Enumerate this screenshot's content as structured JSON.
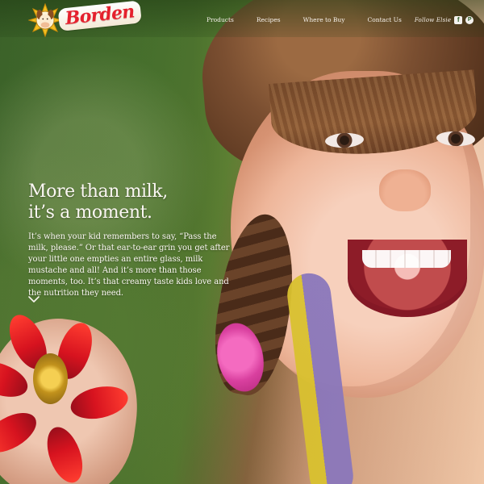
{
  "header": {
    "brand": {
      "wordmark": "Borden",
      "logo_icon": "borden-cow-sunflower-icon"
    },
    "nav": [
      {
        "label": "Products"
      },
      {
        "label": "Recipes"
      },
      {
        "label": "Where to Buy"
      },
      {
        "label": "Contact Us"
      }
    ],
    "follow_label": "Follow Elsie",
    "social": [
      {
        "name": "facebook-icon",
        "glyph": "f"
      },
      {
        "name": "pinterest-icon",
        "glyph": "P"
      }
    ]
  },
  "hero": {
    "headline_line1": "More than milk,",
    "headline_line2": "it’s a moment.",
    "body": "It’s when your kid remembers to say, “Pass the milk, please.” Or that ear-to-ear grin you get after your little one empties an entire glass, milk mustache and all! And it’s more than those moments, too. It’s that creamy taste kids love and the nutrition they need.",
    "scroll_icon": "chevron-down-icon"
  },
  "colors": {
    "brand_red": "#e5202d",
    "text_white": "#fbf7f3",
    "leaf_green": "#5f8e3b",
    "flower_red": "#d7131f"
  }
}
